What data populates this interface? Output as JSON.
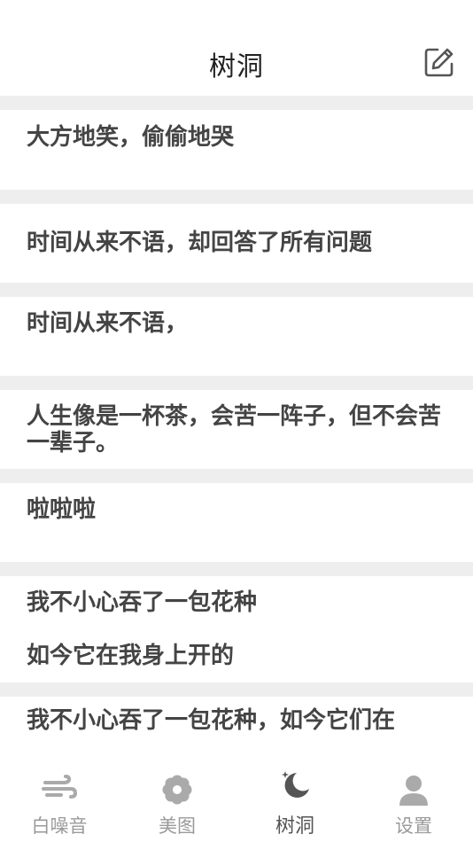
{
  "header": {
    "title": "树洞"
  },
  "posts": [
    {
      "lines": [
        "大方地笑，偷偷地哭"
      ]
    },
    {
      "lines": [
        "时间从来不语，却回答了所有问题"
      ]
    },
    {
      "lines": [
        "时间从来不语，"
      ]
    },
    {
      "lines": [
        "人生像是一杯茶，会苦一阵子，但不会苦",
        "一辈子。"
      ]
    },
    {
      "lines": [
        "啦啦啦"
      ]
    },
    {
      "lines": [
        "我不小心吞了一包花种",
        "",
        "如今它在我身上开的"
      ]
    },
    {
      "lines": [
        "我不小心吞了一包花种，如今它们在"
      ]
    }
  ],
  "tabbar": {
    "tabs": [
      {
        "label": "白噪音",
        "icon": "wind-icon"
      },
      {
        "label": "美图",
        "icon": "flower-icon"
      },
      {
        "label": "树洞",
        "icon": "moon-stars-icon",
        "active": true
      },
      {
        "label": "设置",
        "icon": "person-icon"
      }
    ]
  }
}
